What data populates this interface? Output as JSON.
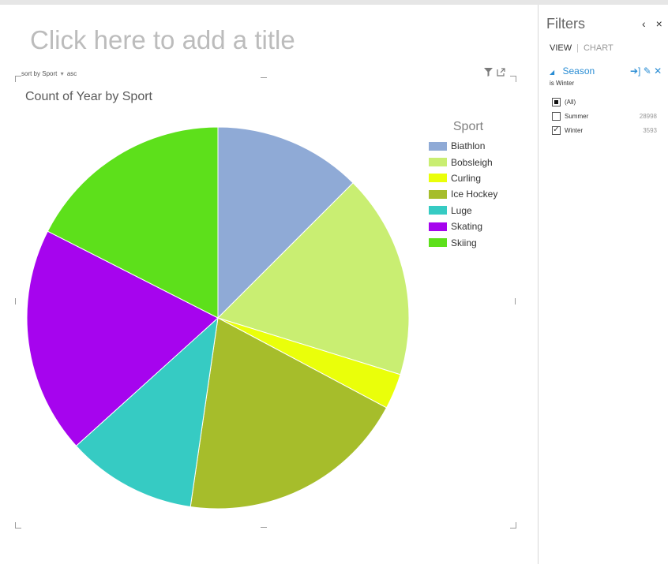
{
  "report": {
    "title_placeholder": "Click here to add a title",
    "sort": {
      "prefix": "sort by",
      "field": "Sport",
      "dropdown_icon": "triangle-down",
      "order": "asc"
    },
    "controls": {
      "filter_icon": "funnel",
      "popout_icon": "popout"
    }
  },
  "chart_data": {
    "type": "pie",
    "title": "Count of Year by Sport",
    "legend_title": "Sport",
    "legend_position": "right",
    "start_angle_deg": 0,
    "direction": "clockwise",
    "slices": [
      {
        "label": "Biathlon",
        "value": 12.5,
        "color": "#8faad6"
      },
      {
        "label": "Bobsleigh",
        "value": 17.3,
        "color": "#c9ee72"
      },
      {
        "label": "Curling",
        "value": 3.0,
        "color": "#eaff0a"
      },
      {
        "label": "Ice Hockey",
        "value": 19.5,
        "color": "#a6bd2b"
      },
      {
        "label": "Luge",
        "value": 11.0,
        "color": "#36cbc3"
      },
      {
        "label": "Skating",
        "value": 19.2,
        "color": "#a604ee"
      },
      {
        "label": "Skiing",
        "value": 17.5,
        "color": "#5de01b"
      }
    ]
  },
  "filters": {
    "title": "Filters",
    "controls": {
      "collapse": "‹",
      "close": "×"
    },
    "tabs": {
      "view": "VIEW",
      "separator": "|",
      "chart": "CHART"
    },
    "field": {
      "name": "Season",
      "summary": "is Winter",
      "icons": {
        "apply": "➔]",
        "clear": "✎",
        "remove": "✕"
      },
      "items": [
        {
          "label": "(All)",
          "state": "partial",
          "count": ""
        },
        {
          "label": "Summer",
          "state": "unchecked",
          "count": "28998"
        },
        {
          "label": "Winter",
          "state": "checked",
          "count": "3593"
        }
      ]
    }
  }
}
